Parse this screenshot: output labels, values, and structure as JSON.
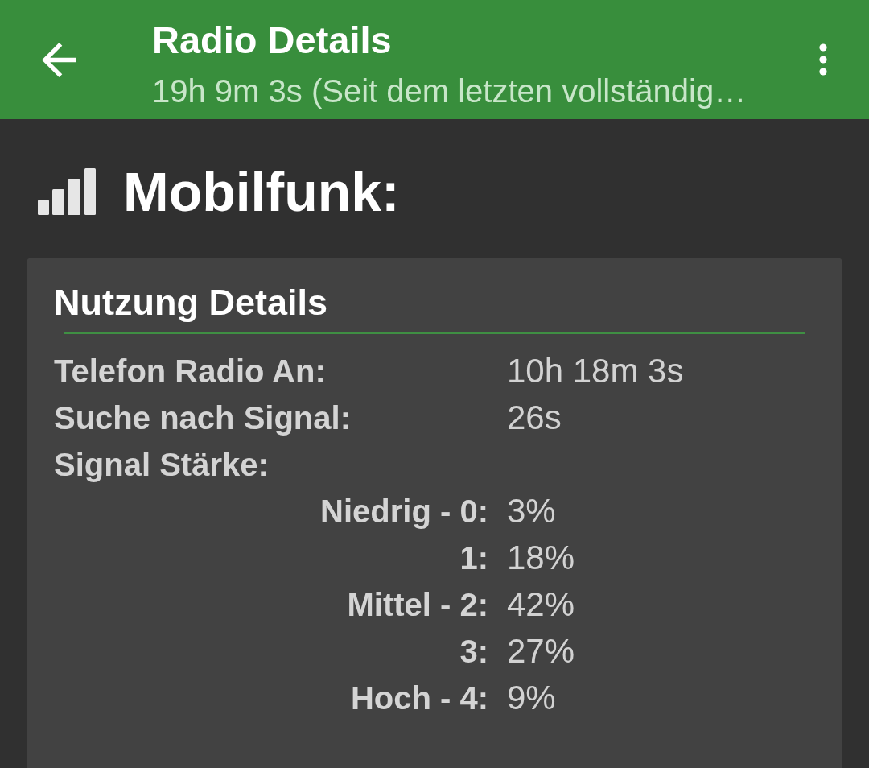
{
  "app_bar": {
    "title": "Radio Details",
    "subtitle": "19h 9m 3s (Seit dem letzten vollständig…"
  },
  "section": {
    "title": "Mobilfunk:"
  },
  "card": {
    "title": "Nutzung Details",
    "rows": [
      {
        "kind": "stat",
        "label": "Telefon Radio An:",
        "value": "10h 18m 3s"
      },
      {
        "kind": "stat",
        "label": "Suche nach Signal:",
        "value": "26s"
      },
      {
        "kind": "heading",
        "label": "Signal Stärke:"
      },
      {
        "kind": "level",
        "label": "Niedrig - 0:",
        "value": "3%"
      },
      {
        "kind": "level",
        "label": "1:",
        "value": "18%"
      },
      {
        "kind": "level",
        "label": "Mittel - 2:",
        "value": "42%"
      },
      {
        "kind": "level",
        "label": "3:",
        "value": "27%"
      },
      {
        "kind": "level",
        "label": "Hoch - 4:",
        "value": "9%"
      }
    ]
  }
}
